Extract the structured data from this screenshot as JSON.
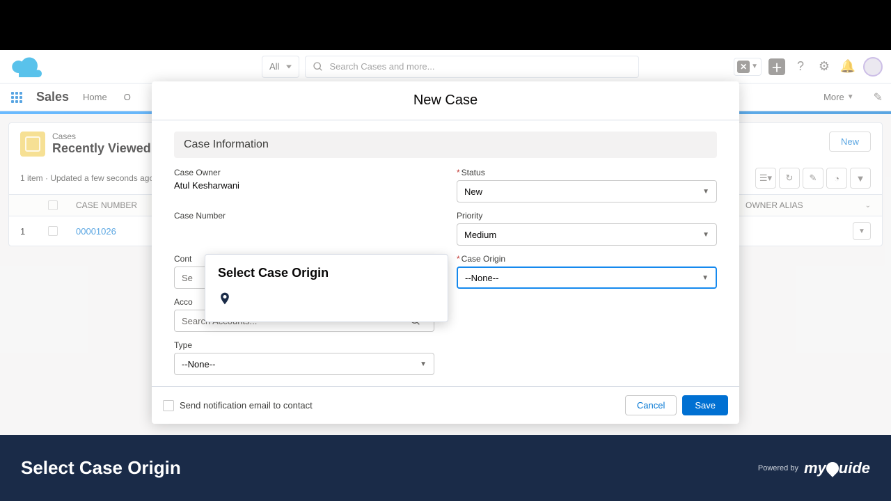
{
  "header": {
    "search_scope": "All",
    "search_placeholder": "Search Cases and more..."
  },
  "nav": {
    "app_name": "Sales",
    "items": [
      "Home",
      "O"
    ],
    "more": "More"
  },
  "page": {
    "object_label": "Cases",
    "view_name": "Recently Viewed",
    "subtext": "1 item · Updated a few seconds ago",
    "new_button": "New",
    "columns": {
      "case_number": "CASE NUMBER",
      "owner_alias": "OWNER ALIAS"
    },
    "rows": [
      {
        "idx": "1",
        "case_number": "00001026"
      }
    ]
  },
  "modal": {
    "title": "New Case",
    "section": "Case Information",
    "labels": {
      "case_owner": "Case Owner",
      "case_number": "Case Number",
      "contact_name": "Cont",
      "account_name": "Acco",
      "type": "Type",
      "status": "Status",
      "priority": "Priority",
      "case_origin": "Case Origin"
    },
    "values": {
      "case_owner": "Atul Kesharwani",
      "contact_placeholder": "Se",
      "account_placeholder": "Search Accounts...",
      "type": "--None--",
      "status": "New",
      "priority": "Medium",
      "case_origin": "--None--"
    },
    "footer": {
      "notify": "Send notification email to contact",
      "cancel": "Cancel",
      "save": "Save"
    }
  },
  "tooltip": {
    "title": "Select Case Origin"
  },
  "bottom": {
    "title": "Select Case Origin",
    "powered_by": "Powered by",
    "brand": "myguide"
  }
}
